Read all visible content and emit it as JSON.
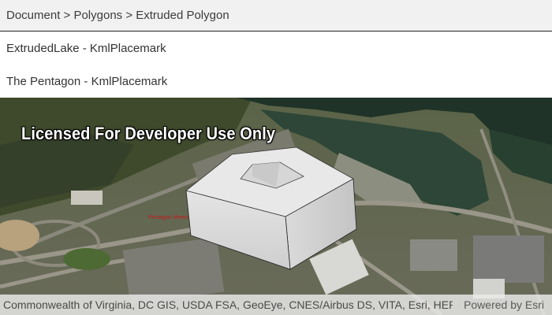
{
  "breadcrumb": {
    "text": "Document > Polygons > Extruded Polygon"
  },
  "list": {
    "items": [
      {
        "label": "ExtrudedLake - KmlPlacemark"
      },
      {
        "label": "The Pentagon - KmlPlacemark"
      }
    ]
  },
  "map": {
    "watermark": "Licensed For Developer Use Only",
    "attribution": "Commonwealth of Virginia, DC GIS, USDA FSA, GeoEye, CNES/Airbus DS, VITA, Esri, HERE...",
    "powered_by": "Powered by Esri",
    "label_memorial": "Pentagon Memorial",
    "colors": {
      "water": "#2e4636",
      "land": "#4f5c3d",
      "polygon": "#e2e2e2"
    }
  }
}
